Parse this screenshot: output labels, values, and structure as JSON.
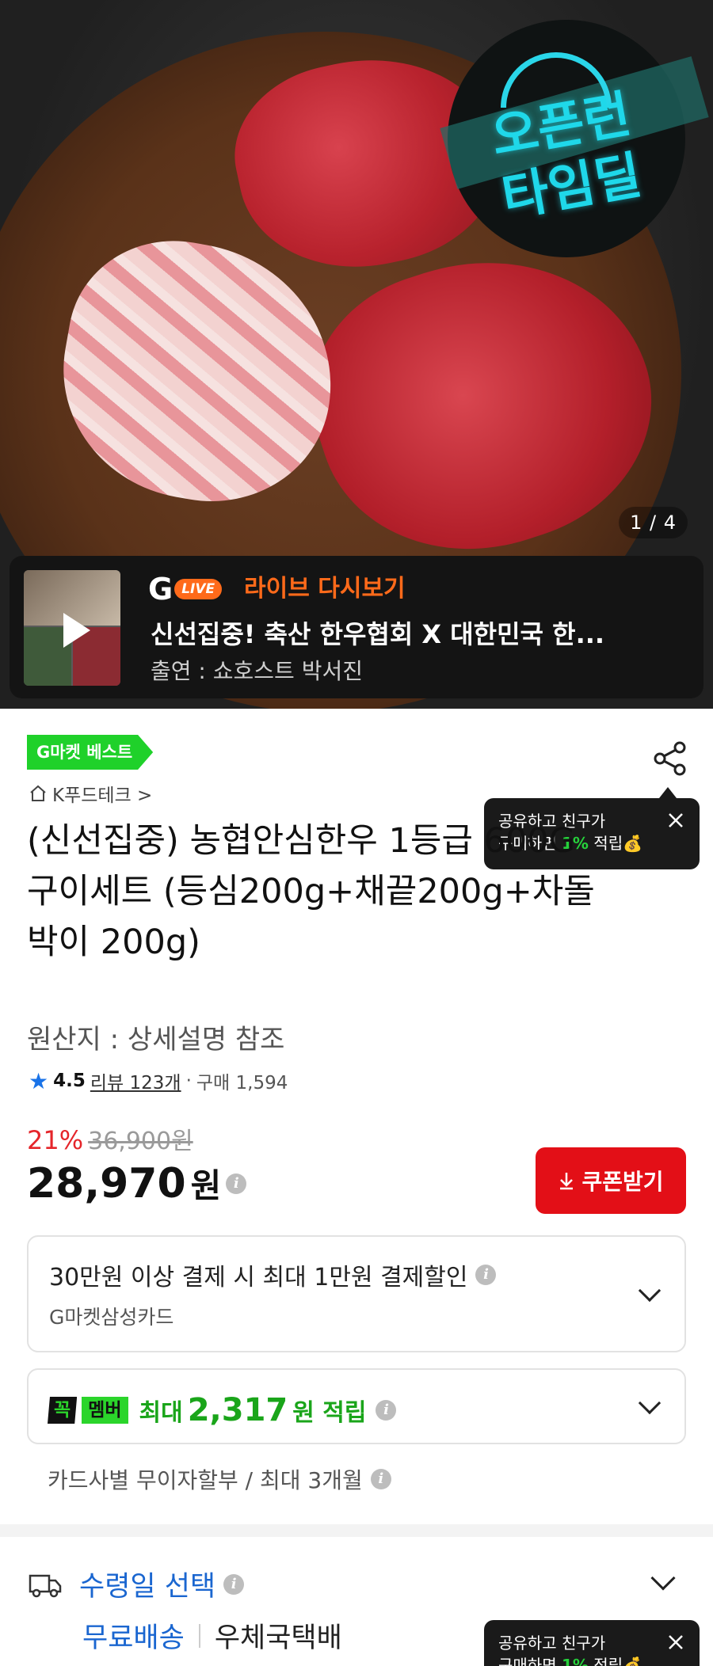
{
  "hero": {
    "badge_line1": "오픈런",
    "badge_line2": "타임딜",
    "counter": "1 / 4"
  },
  "live": {
    "logo_g": "G",
    "logo_live": "LIVE",
    "replay_label": "라이브 다시보기",
    "title": "신선집중! 축산 한우협회 X 대한민국 한...",
    "cast": "출연 : 쇼호스트 박서진"
  },
  "product": {
    "best_badge": "G마켓 베스트",
    "store": "K푸드테크 >",
    "title": "(신선집중) 농협안심한우 1등급 600G 구이세트 (등심200g+채끝200g+차돌박이 200g)",
    "origin": "원산지 : 상세설명 참조",
    "rating": {
      "score": "4.5",
      "review": "리뷰 123개",
      "separator": "·",
      "purchases": "구매 1,594"
    },
    "discount_rate": "21%",
    "original_price": "36,900원",
    "price": "28,970",
    "currency": "원",
    "info_icon": "i",
    "coupon_button": "쿠폰받기"
  },
  "share_tooltip": {
    "line1": "공유하고 친구가",
    "line2_prefix": "구매하면 ",
    "line2_rate": "1%",
    "line2_suffix": " 적립💰"
  },
  "payment_benefit": {
    "line1": "30만원 이상 결제 시 최대 1만원 결제할인",
    "line2": "G마켓삼성카드"
  },
  "membership": {
    "badge_left": "꼭",
    "badge_right": "멤버",
    "text_prefix": "최대",
    "amount": "2,317",
    "text_suffix": "원 적립"
  },
  "installment": "카드사별 무이자할부 / 최대 3개월",
  "delivery": {
    "label": "수령일 선택",
    "free": "무료배송",
    "carrier": "우체국택배"
  },
  "colors": {
    "accent_red": "#e30f17",
    "discount_red": "#e5252a",
    "green": "#1fd12a",
    "blue": "#1a66d0",
    "live_orange": "#ff6a1a"
  }
}
